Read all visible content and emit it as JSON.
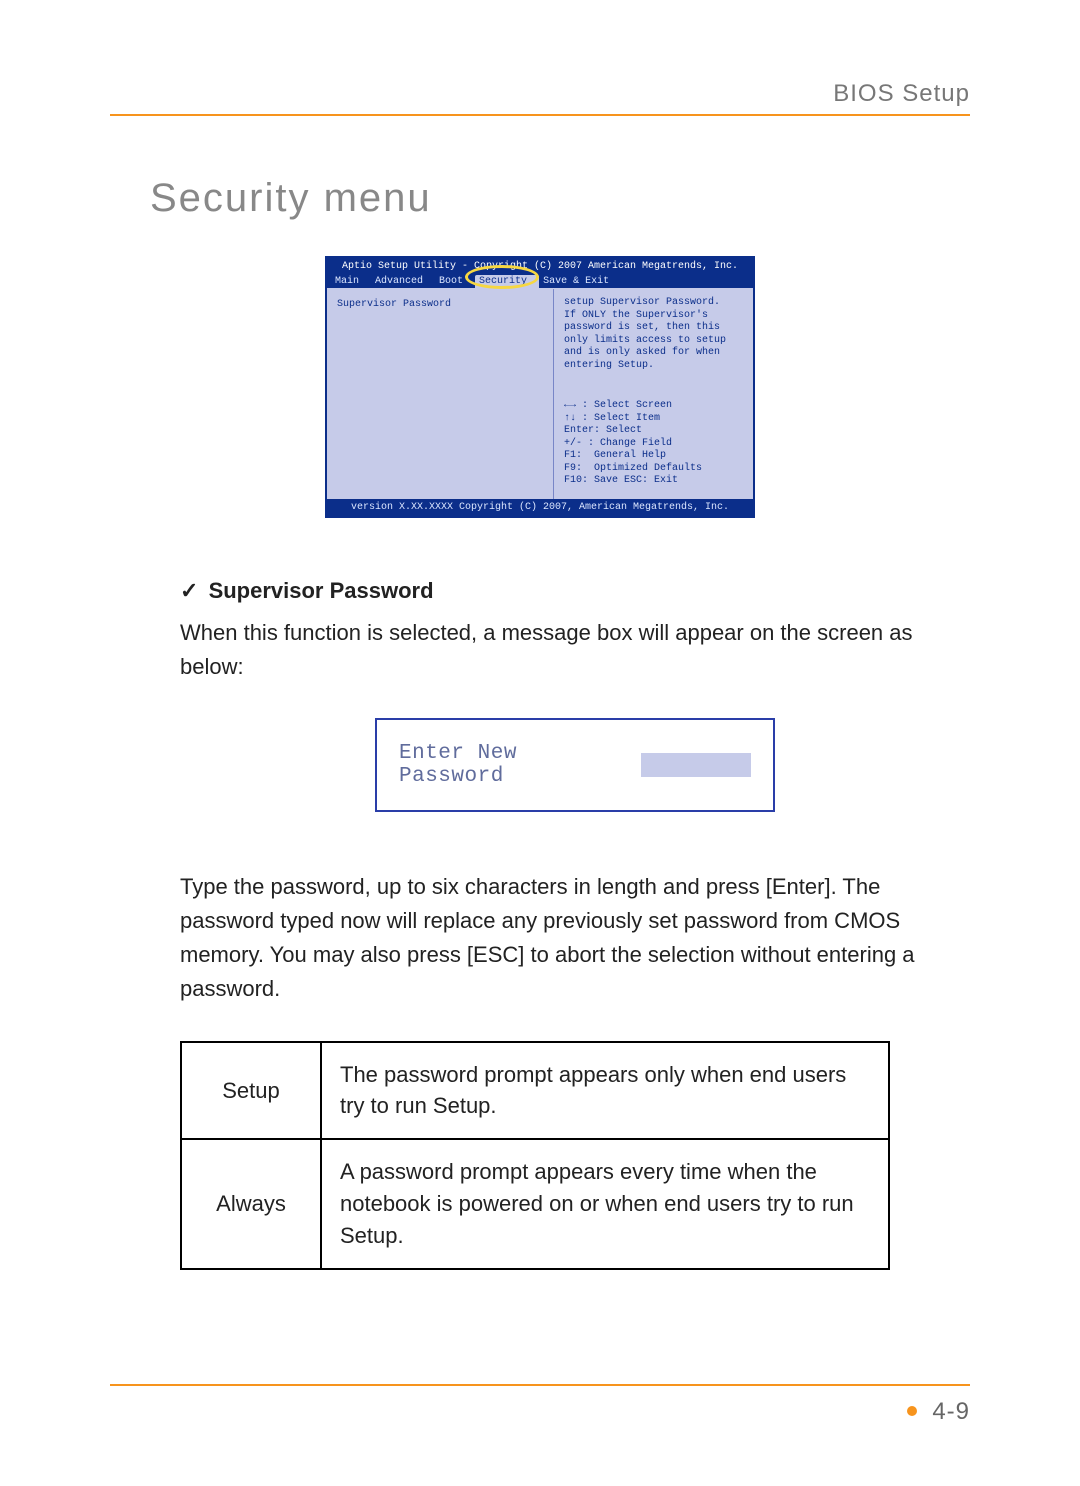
{
  "header": {
    "label": "BIOS Setup"
  },
  "section_title": "Security menu",
  "bios": {
    "header_line": "Aptio Setup Utility - Copyright (C) 2007 American Megatrends, Inc.",
    "tabs": [
      {
        "label": "Main"
      },
      {
        "label": "Advanced"
      },
      {
        "label": "Boot"
      },
      {
        "label": "Security",
        "active": true
      },
      {
        "label": "Save & Exit"
      }
    ],
    "left_item": "Supervisor Password",
    "help_text": "setup Supervisor Password.\nIf ONLY the Supervisor's password is set, then this only limits access to setup and is only asked for when entering Setup.",
    "keys": [
      "←→ : Select Screen",
      "↑↓ : Select Item",
      "Enter: Select",
      "+/- : Change Field",
      "F1:  General Help",
      "F9:  Optimized Defaults",
      "F10: Save ESC: Exit"
    ],
    "footer_line": "version X.XX.XXXX Copyright (C) 2007, American Megatrends, Inc."
  },
  "feature": {
    "check": "✓",
    "title": "Supervisor Password",
    "para1": "When this function is selected, a message box will appear on the screen as below:",
    "pw_prompt": "Enter New Password",
    "para2": "Type the password, up to six characters in length and press [Enter]. The password typed now will replace any previously set password from CMOS memory. You may also press [ESC] to abort the selection without entering a password."
  },
  "table": {
    "rows": [
      {
        "key": "Setup",
        "desc": "The password prompt appears only when end users try to run Setup."
      },
      {
        "key": "Always",
        "desc": "A password prompt appears every time when the notebook is powered on or when end users try to run Setup."
      }
    ]
  },
  "page_number": "4-9"
}
